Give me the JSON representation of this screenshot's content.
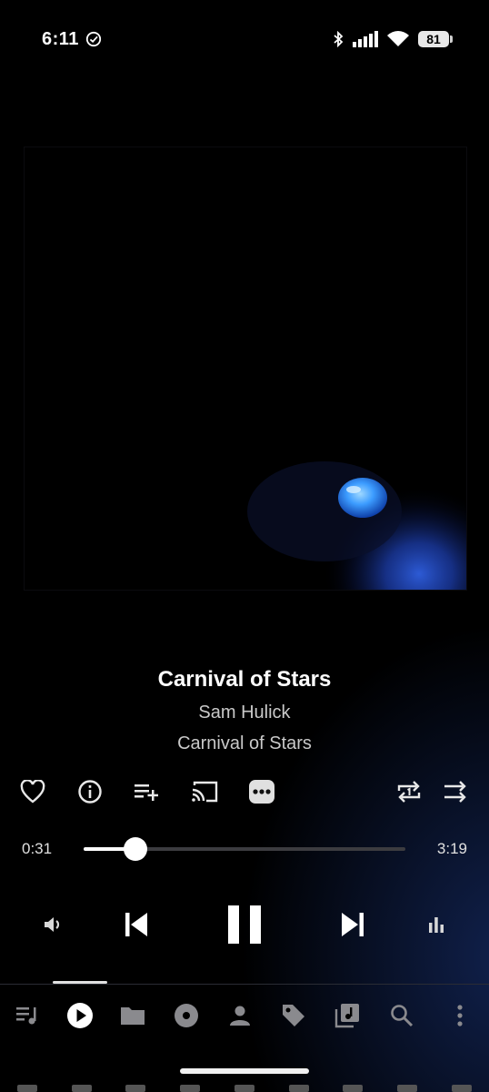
{
  "status_bar": {
    "time": "6:11",
    "battery": "81"
  },
  "track": {
    "title": "Carnival of Stars",
    "artist": "Sam Hulick",
    "album": "Carnival of Stars"
  },
  "playback": {
    "elapsed": "0:31",
    "total": "3:19",
    "progress_fraction": 0.16,
    "state": "playing"
  },
  "actions": [
    "heart-icon",
    "info-icon",
    "add-to-queue-icon",
    "cast-icon",
    "more-options-icon",
    "repeat-one-icon",
    "shuffle-icon"
  ],
  "bottom_nav": {
    "items": [
      "queue-icon",
      "now-playing-icon",
      "folders-icon",
      "albums-icon",
      "artists-icon",
      "genres-icon",
      "playlists-icon",
      "search-icon",
      "overflow-menu-icon"
    ],
    "selected": "now-playing-icon"
  },
  "colors": {
    "accent": "#ffffff",
    "background": "#000000",
    "glow": "#1e3c8c"
  }
}
